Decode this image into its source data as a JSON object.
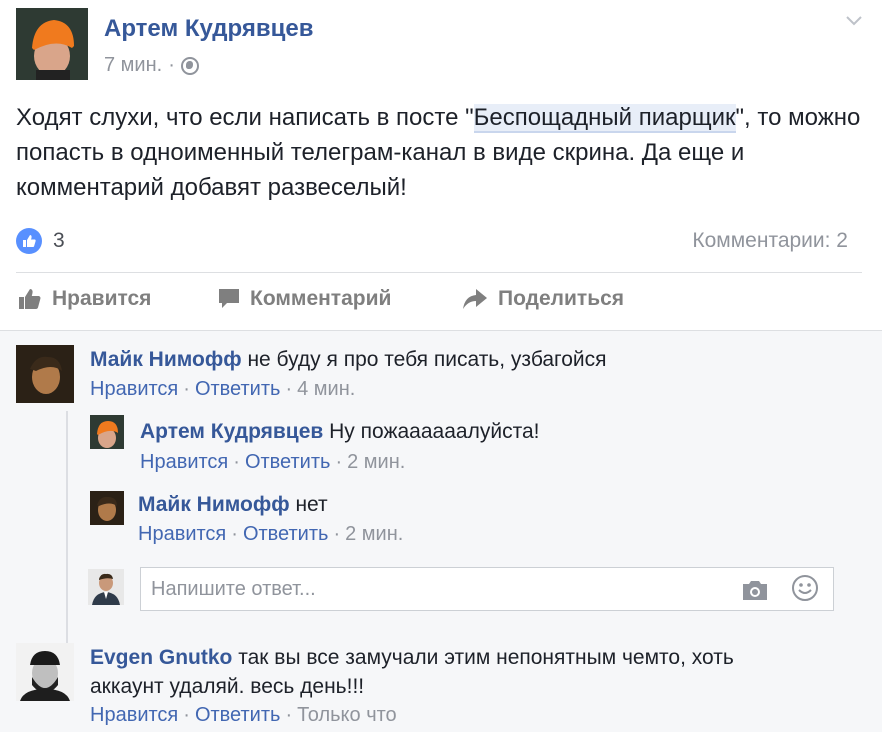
{
  "post": {
    "author": "Артем Кудрявцев",
    "time": "7 мин.",
    "meta_separator": "·",
    "text_before": "Ходят слухи, что если написать в посте \"",
    "text_highlight": "Беспощадный пиарщик",
    "text_after": "\", то можно попасть в одноименный телеграм-канал в виде скрина. Да еще и комментарий добавят развеселый!",
    "likes_count": "3",
    "comments_count": "Комментарии: 2"
  },
  "actions": {
    "like": "Нравится",
    "comment": "Комментарий",
    "share": "Поделиться"
  },
  "comments": [
    {
      "name": "Майк Нимофф",
      "text": "не буду я про тебя писать, узбагойся",
      "like": "Нравится",
      "reply": "Ответить",
      "time": "4 мин.",
      "sep": "·"
    },
    {
      "name": "Артем Кудрявцев",
      "text": "Ну пожаааааалуйста!",
      "like": "Нравится",
      "reply": "Ответить",
      "time": "2 мин.",
      "sep": "·"
    },
    {
      "name": "Майк Нимофф",
      "text": "нет",
      "like": "Нравится",
      "reply": "Ответить",
      "time": "2 мин.",
      "sep": "·"
    },
    {
      "name": "Evgen Gnutko",
      "text": "так вы все замучали этим непонятным чемто, хоть аккаунт удаляй. весь день!!!",
      "like": "Нравится",
      "reply": "Ответить",
      "time": "Только что",
      "sep": "·"
    }
  ],
  "reply_box": {
    "placeholder": "Напишите ответ..."
  },
  "colors": {
    "link": "#365899",
    "action_link": "#4267b2",
    "muted": "#90949c",
    "like_blue": "#5890ff",
    "comments_bg": "#f6f7f9"
  },
  "icons": [
    "chevron-down-icon",
    "globe-icon",
    "like-reaction-icon",
    "thumbs-up-icon",
    "comment-icon",
    "share-icon",
    "camera-icon",
    "smiley-icon"
  ]
}
